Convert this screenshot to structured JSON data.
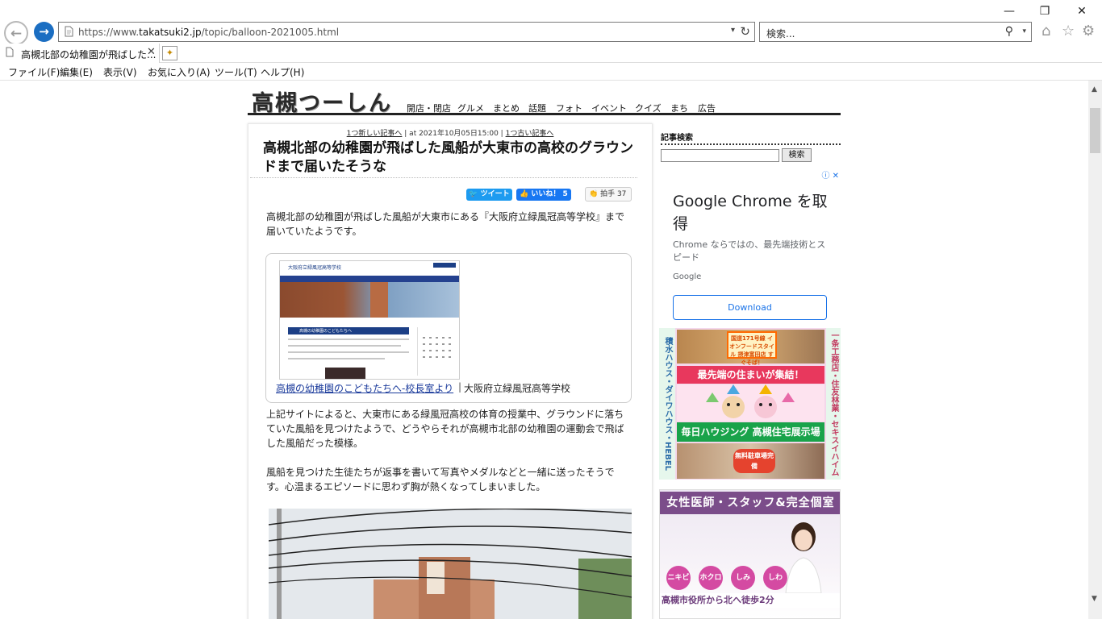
{
  "window": {
    "minimize_glyph": "—",
    "restore_glyph": "❐",
    "close_glyph": "✕"
  },
  "nav": {
    "back_glyph": "←",
    "forward_glyph": "→"
  },
  "address_bar": {
    "url_prefix": "https://www.",
    "url_domain": "takatsuki2.jp",
    "url_path": "/topic/balloon-2021005.html"
  },
  "search": {
    "placeholder": "検索..."
  },
  "toolbar_icons": [
    "home-icon",
    "star-icon",
    "gear-icon"
  ],
  "tab": {
    "title": "高槻北部の幼稚園が飛ばした...",
    "close_glyph": "✕"
  },
  "menu": [
    "ファイル(F)",
    "編集(E)",
    "表示(V)",
    "お気に入り(A)",
    "ツール(T)",
    "ヘルプ(H)"
  ],
  "site": {
    "logo": "高槻つーしん",
    "nav": [
      "開店・閉店",
      "グルメ",
      "まとめ",
      "話題",
      "フォト",
      "イベント",
      "クイズ",
      "まち",
      "広告"
    ]
  },
  "article": {
    "newer_link": "1つ新しい記事へ",
    "meta_mid": "| at 2021年10月05日15:00 |",
    "older_link": "1つ古い記事へ",
    "title": "高槻北部の幼稚園が飛ばした風船が大東市の高校のグラウンドまで届いたそうな",
    "tweet_label": "ツイート",
    "like_label": "いいね！ 5",
    "clap_label": "拍手 37",
    "p1": "高槻北部の幼稚園が飛ばした風船が大東市にある『大阪府立緑風冠高等学校』まで届いていたようです。",
    "embed_link": "高槻の幼稚園のこどもたちへ-校長室より",
    "embed_sep": "|",
    "embed_caption": "大阪府立緑風冠高等学校",
    "embed_shot_header": "大阪府立緑風冠高等学校",
    "embed_shot_headline": "高槻の幼稚園のこどもたちへ",
    "p2": "上記サイトによると、大東市にある緑風冠高校の体育の授業中、グラウンドに落ちていた風船を見つけたようで、どうやらそれが高槻市北部の幼稚園の運動会で飛ばした風船だった模様。",
    "p3": "風船を見つけた生徒たちが返事を書いて写真やメダルなどと一緒に送ったそうです。心温まるエピソードに思わず胸が熱くなってしまいました。"
  },
  "sidebar": {
    "heading": "記事検索",
    "search_button": "検索"
  },
  "ad_chrome": {
    "title": "Google Chrome を取得",
    "body": "Chrome ならではの、最先端技術とスピード",
    "brand": "Google",
    "button": "Download",
    "adchoices": "ⓘ ✕"
  },
  "ad_house": {
    "left_text": "積水ハウス・ダイワハウス・HEBEL HAUS",
    "right_text": "一条工務店・住友林業・セキスイハイム",
    "sign_text": "国道171号線 イオンフードスタイル 摂津富田店 すぐそば！",
    "banner1": "最先端の住まいが集結！",
    "banner2": "毎日ハウジング 高槻住宅展示場",
    "parking": "無料駐車場完備"
  },
  "ad_clinic": {
    "banner": "女性医師・スタッフ&完全個室",
    "bubbles": [
      "ニキビ",
      "ホクロ",
      "しみ",
      "しわ"
    ],
    "footer": "高槻市役所から北へ徒歩2分"
  }
}
